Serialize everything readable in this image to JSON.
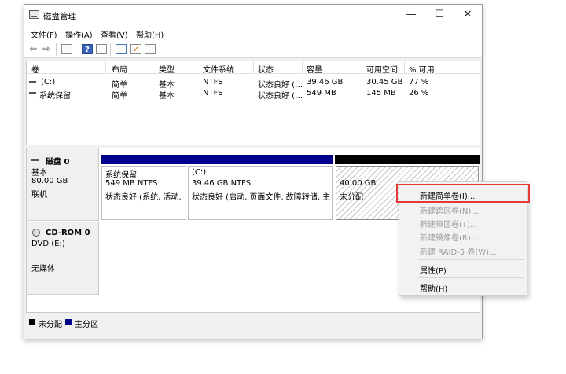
{
  "window": {
    "title": "磁盘管理",
    "controls": {
      "minimize": "—",
      "maximize": "☐",
      "close": "✕"
    }
  },
  "menu": [
    "文件(F)",
    "操作(A)",
    "查看(V)",
    "帮助(H)"
  ],
  "toolbar": {
    "back_glyph": "⇦",
    "forward_glyph": "⇨",
    "help_glyph": "?",
    "icons": [
      "back-arrow-icon",
      "forward-arrow-icon",
      "properties-icon",
      "help-icon",
      "refresh-icon",
      "rescan-icon",
      "check-icon"
    ]
  },
  "volume_list": {
    "columns": [
      "卷",
      "布局",
      "类型",
      "文件系统",
      "状态",
      "容量",
      "可用空间",
      "% 可用"
    ],
    "rows": [
      [
        "(C:)",
        "简单",
        "基本",
        "NTFS",
        "状态良好 (…",
        "39.46 GB",
        "30.45 GB",
        "77 %"
      ],
      [
        "系统保留",
        "简单",
        "基本",
        "NTFS",
        "状态良好 (…",
        "549 MB",
        "145 MB",
        "26 %"
      ]
    ]
  },
  "disks": {
    "disk0": {
      "name": "磁盘 0",
      "type": "基本",
      "size": "80.00 GB",
      "status": "联机",
      "partitions": [
        {
          "name": "系统保留",
          "size": "549 MB NTFS",
          "status": "状态良好 (系统, 活动, 主"
        },
        {
          "name": "(C:)",
          "size": "39.46 GB NTFS",
          "status": "状态良好 (启动, 页面文件, 故障转储, 主分"
        },
        {
          "name": "",
          "size": "40.00 GB",
          "status": "未分配"
        }
      ]
    },
    "cdrom0": {
      "name": "CD-ROM 0",
      "type": "DVD (E:)",
      "status": "无媒体"
    }
  },
  "legend": {
    "unallocated": "未分配",
    "primary": "主分区"
  },
  "colors": {
    "primary_bar": "#00008b",
    "unallocated_bar": "#000000",
    "highlight": "#e53935"
  },
  "context_menu": {
    "items": [
      {
        "label": "新建简单卷(I)...",
        "enabled": true
      },
      {
        "label": "新建跨区卷(N)...",
        "enabled": false
      },
      {
        "label": "新建带区卷(T)...",
        "enabled": false
      },
      {
        "label": "新建镜像卷(R)...",
        "enabled": false
      },
      {
        "label": "新建 RAID-5 卷(W)...",
        "enabled": false
      },
      {
        "label": "属性(P)",
        "enabled": true
      },
      {
        "label": "帮助(H)",
        "enabled": true
      }
    ]
  }
}
